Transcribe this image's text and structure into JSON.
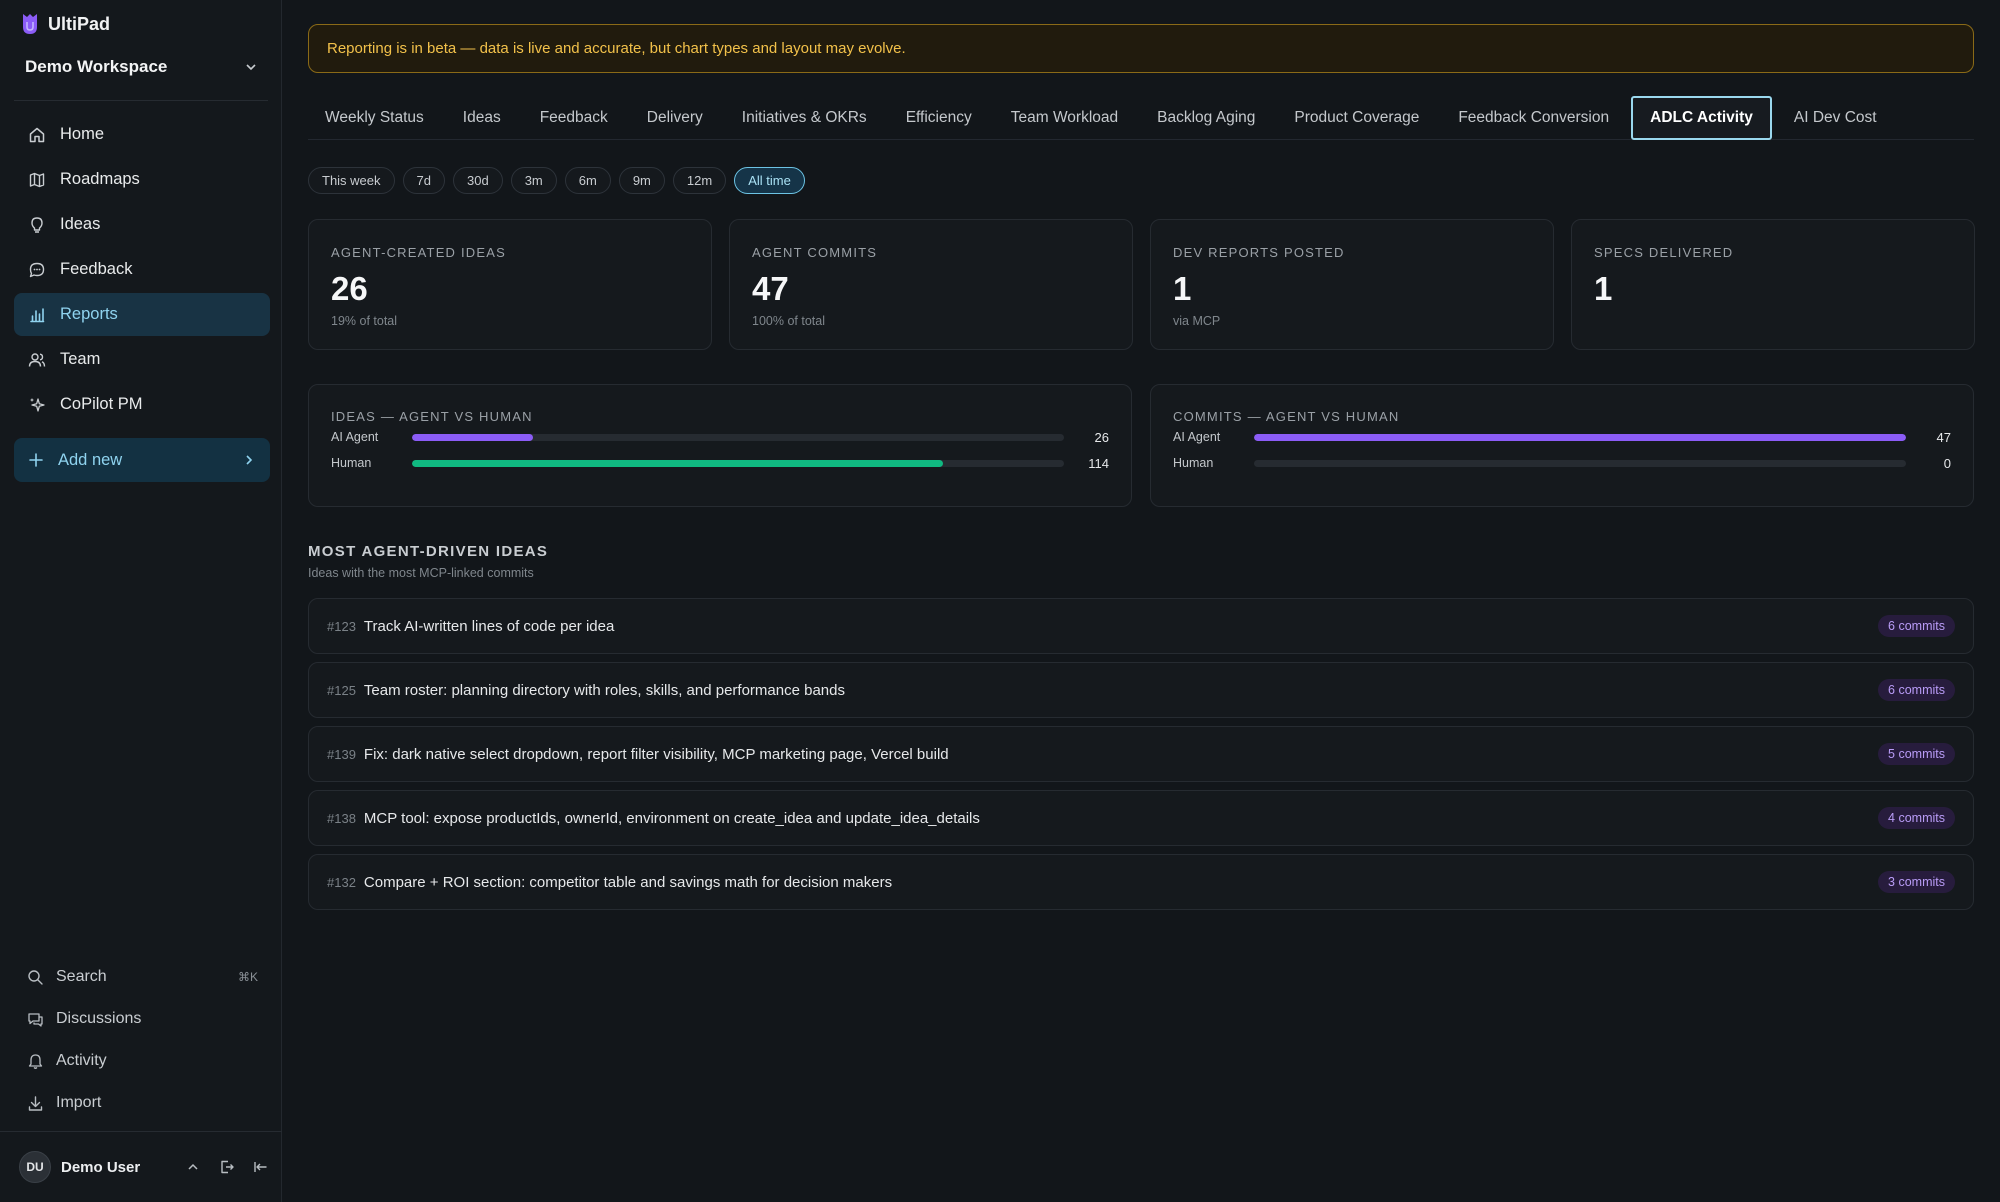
{
  "app": {
    "name": "UltiPad",
    "workspace": "Demo Workspace"
  },
  "sidebar": {
    "items": [
      {
        "label": "Home",
        "icon": "home-icon"
      },
      {
        "label": "Roadmaps",
        "icon": "map-icon"
      },
      {
        "label": "Ideas",
        "icon": "lightbulb-icon"
      },
      {
        "label": "Feedback",
        "icon": "chat-icon"
      },
      {
        "label": "Reports",
        "icon": "bar-chart-icon",
        "active": true
      },
      {
        "label": "Team",
        "icon": "users-icon"
      },
      {
        "label": "CoPilot PM",
        "icon": "sparkle-icon"
      }
    ],
    "add_new": "Add new",
    "utility": [
      {
        "label": "Search",
        "shortcut": "⌘K",
        "icon": "search-icon"
      },
      {
        "label": "Discussions",
        "icon": "discussion-icon"
      },
      {
        "label": "Activity",
        "icon": "bell-icon"
      },
      {
        "label": "Import",
        "icon": "download-icon"
      }
    ],
    "user": {
      "initials": "DU",
      "name": "Demo User"
    }
  },
  "banner": "Reporting is in beta — data is live and accurate, but chart types and layout may evolve.",
  "tabs": [
    "Weekly Status",
    "Ideas",
    "Feedback",
    "Delivery",
    "Initiatives & OKRs",
    "Efficiency",
    "Team Workload",
    "Backlog Aging",
    "Product Coverage",
    "Feedback Conversion",
    "ADLC Activity",
    "AI Dev Cost"
  ],
  "active_tab": "ADLC Activity",
  "ranges": [
    "This week",
    "7d",
    "30d",
    "3m",
    "6m",
    "9m",
    "12m",
    "All time"
  ],
  "active_range": "All time",
  "stats": [
    {
      "label": "AGENT-CREATED IDEAS",
      "value": "26",
      "sub": "19% of total"
    },
    {
      "label": "AGENT COMMITS",
      "value": "47",
      "sub": "100% of total"
    },
    {
      "label": "DEV REPORTS POSTED",
      "value": "1",
      "sub": "via MCP"
    },
    {
      "label": "SPECS DELIVERED",
      "value": "1",
      "sub": ""
    }
  ],
  "comparisons": {
    "ideas": {
      "title": "IDEAS — AGENT VS HUMAN",
      "rows": [
        {
          "label": "AI Agent",
          "value": 26,
          "fill": 0.186,
          "color": "#8b5cf6"
        },
        {
          "label": "Human",
          "value": 114,
          "fill": 0.814,
          "color": "#10b981"
        }
      ]
    },
    "commits": {
      "title": "COMMITS — AGENT VS HUMAN",
      "rows": [
        {
          "label": "AI Agent",
          "value": 47,
          "fill": 1.0,
          "color": "#8b5cf6"
        },
        {
          "label": "Human",
          "value": 0,
          "fill": 0.0,
          "color": "#10b981"
        }
      ]
    }
  },
  "section": {
    "title": "MOST AGENT-DRIVEN IDEAS",
    "subtitle": "Ideas with the most MCP-linked commits"
  },
  "ideas": [
    {
      "num": "#123",
      "title": "Track AI-written lines of code per idea",
      "commits": "6 commits"
    },
    {
      "num": "#125",
      "title": "Team roster: planning directory with roles, skills, and performance bands",
      "commits": "6 commits"
    },
    {
      "num": "#139",
      "title": "Fix: dark native select dropdown, report filter visibility, MCP marketing page, Vercel build",
      "commits": "5 commits"
    },
    {
      "num": "#138",
      "title": "MCP tool: expose productIds, ownerId, environment on create_idea and update_idea_details",
      "commits": "4 commits"
    },
    {
      "num": "#132",
      "title": "Compare + ROI section: competitor table and savings math for decision makers",
      "commits": "3 commits"
    }
  ]
}
